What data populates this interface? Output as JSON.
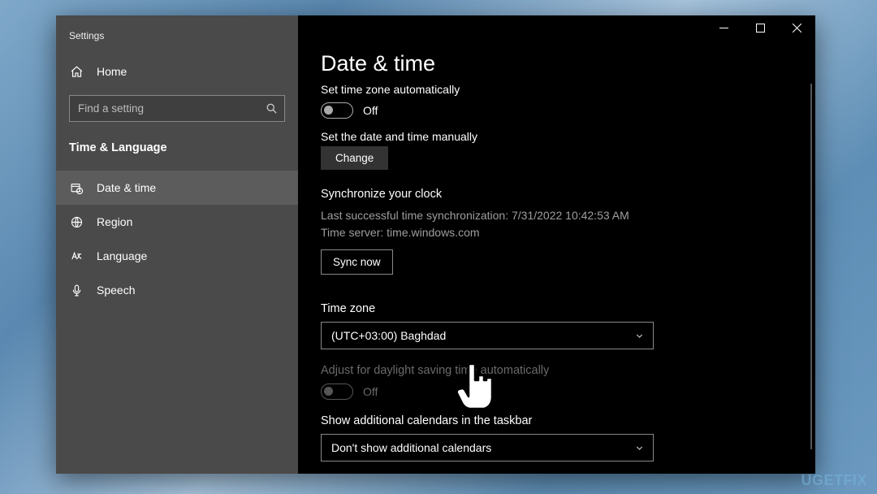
{
  "app_title": "Settings",
  "home_label": "Home",
  "search": {
    "placeholder": "Find a setting"
  },
  "category": "Time & Language",
  "nav": [
    {
      "label": "Date & time"
    },
    {
      "label": "Region"
    },
    {
      "label": "Language"
    },
    {
      "label": "Speech"
    }
  ],
  "page": {
    "title": "Date & time",
    "auto_tz_label": "Set time zone automatically",
    "auto_tz_state": "Off",
    "manual_label": "Set the date and time manually",
    "change_btn": "Change",
    "sync_header": "Synchronize your clock",
    "sync_last": "Last successful time synchronization: 7/31/2022 10:42:53 AM",
    "sync_server": "Time server: time.windows.com",
    "sync_btn": "Sync now",
    "tz_header": "Time zone",
    "tz_value": "(UTC+03:00) Baghdad",
    "dst_label": "Adjust for daylight saving time automatically",
    "dst_state": "Off",
    "calendars_header": "Show additional calendars in the taskbar",
    "calendars_value": "Don't show additional calendars"
  },
  "watermark": "UGETFIX"
}
